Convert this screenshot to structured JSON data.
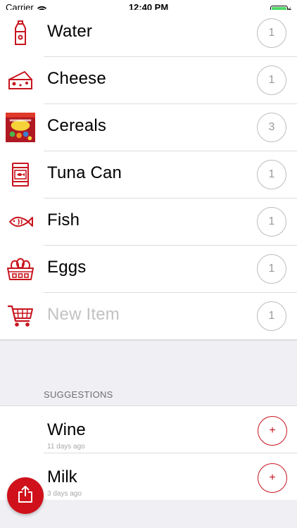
{
  "status_bar": {
    "carrier": "Carrier",
    "time": "12:40 PM",
    "wifi_icon": "wifi-icon",
    "battery_icon": "battery-charging-icon"
  },
  "items": [
    {
      "name": "Water",
      "count": "1",
      "icon": "water-bottle-icon"
    },
    {
      "name": "Cheese",
      "count": "1",
      "icon": "cheese-icon"
    },
    {
      "name": "Cereals",
      "count": "3",
      "icon": "cereal-box-photo"
    },
    {
      "name": "Tuna Can",
      "count": "1",
      "icon": "tuna-can-icon"
    },
    {
      "name": "Fish",
      "count": "1",
      "icon": "fish-icon"
    },
    {
      "name": "Eggs",
      "count": "1",
      "icon": "egg-carton-icon"
    }
  ],
  "new_item": {
    "placeholder": "New Item",
    "count": "1",
    "icon": "shopping-cart-icon"
  },
  "suggestions": {
    "header": "SUGGESTIONS",
    "items": [
      {
        "name": "Wine",
        "last_bought": "11 days ago",
        "add_label": "+"
      },
      {
        "name": "Milk",
        "last_bought": "3 days ago",
        "add_label": "+"
      }
    ]
  },
  "share_button": {
    "icon": "share-icon"
  },
  "colors": {
    "accent": "#d0111b",
    "background_gray": "#efeff4",
    "separator": "#dcdcdc"
  }
}
